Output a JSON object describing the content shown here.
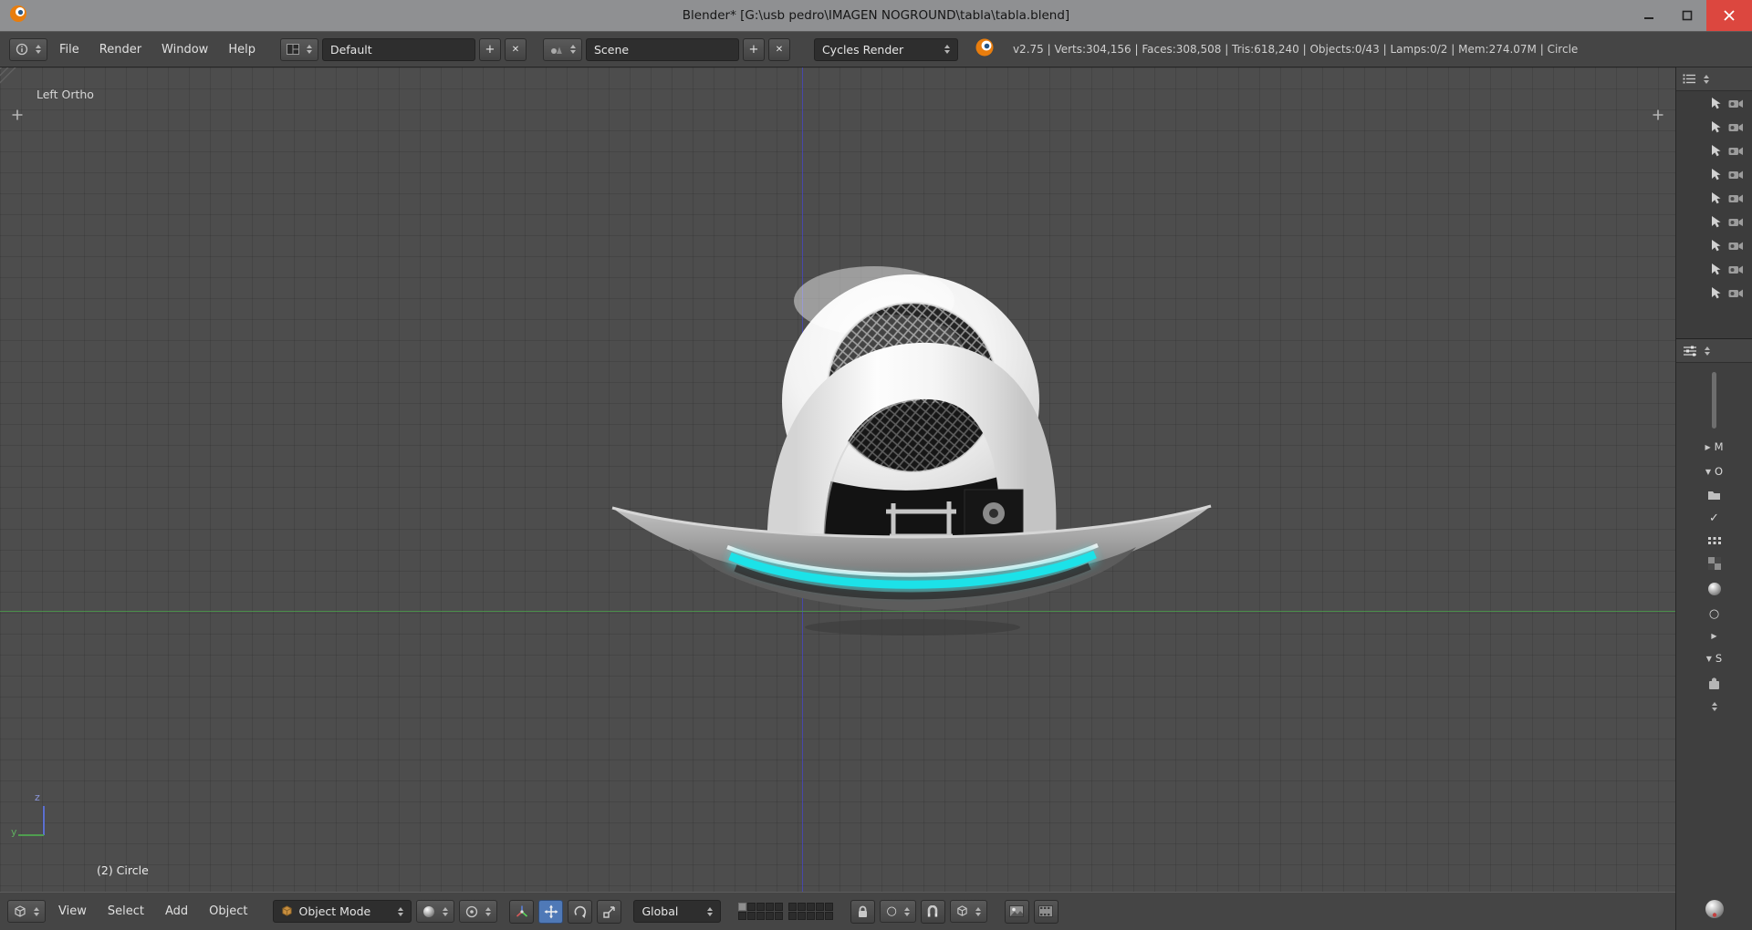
{
  "window": {
    "title": "Blender* [G:\\usb pedro\\IMAGEN NOGROUND\\tabla\\tabla.blend]"
  },
  "topbar": {
    "menus": [
      "File",
      "Render",
      "Window",
      "Help"
    ],
    "layout_value": "Default",
    "scene_value": "Scene",
    "engine_value": "Cycles Render",
    "stats": "v2.75 | Verts:304,156 | Faces:308,508 | Tris:618,240 | Objects:0/43 | Lamps:0/2 | Mem:274.07M | Circle"
  },
  "viewport": {
    "view_label": "Left Ortho",
    "selection_label": "(2) Circle",
    "axis_z": "z",
    "axis_y": "y",
    "colors": {
      "glow_cyan": "#1ce2e8",
      "axis_y_green": "#4a9a4a",
      "axis_z_blue": "#4646c0",
      "background": "#4d4d4d"
    }
  },
  "bottombar": {
    "menus": [
      "View",
      "Select",
      "Add",
      "Object"
    ],
    "mode_value": "Object Mode",
    "orientation_value": "Global"
  },
  "side": {
    "material_tab": "M",
    "object_tab": "O",
    "scene_tab": "S"
  },
  "icons": {
    "plus": "+",
    "cross": "✕",
    "check": "✓",
    "circle": "○",
    "tri_right": "▶",
    "tri_down": "▼"
  }
}
